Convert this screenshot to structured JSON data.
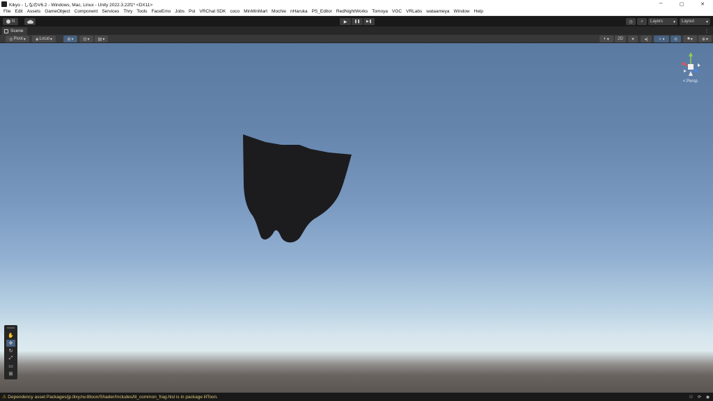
{
  "window": {
    "title": "Kikyo - しなのV6.2 - Windows, Mac, Linux - Unity 2022.3.22f1* <DX11>",
    "minimize": "─",
    "maximize": "▢",
    "close": "✕"
  },
  "menu": [
    "File",
    "Edit",
    "Assets",
    "GameObject",
    "Component",
    "Services",
    "Thry",
    "Tools",
    "FaceEmo",
    "Jobs",
    "Poi",
    "VRChat SDK",
    "coco",
    "MinMinMart",
    "Mochie",
    "nHaruka",
    "PS_Editor",
    "RedNightWorks",
    "Tomoya",
    "VGC",
    "VRLabs",
    "wataameya",
    "Window",
    "Help"
  ],
  "toolbar": {
    "account_label": "N",
    "play": "▶",
    "pause": "❚❚",
    "step": "▶❚",
    "layers_label": "Layers",
    "layout_label": "Layout"
  },
  "scene_tab": {
    "label": "Scene",
    "menu": "⋮"
  },
  "scene_toolbar": {
    "pivot_label": "Pivot",
    "local_label": "Local",
    "mode_2d": "2D"
  },
  "gizmo": {
    "persp_label": "< Persp"
  },
  "status": {
    "message": "Dependency asset Packages/jp.lilxyzw.liltoon/Shader/Includes/lil_common_frag.hlsl is in package lilToon."
  }
}
